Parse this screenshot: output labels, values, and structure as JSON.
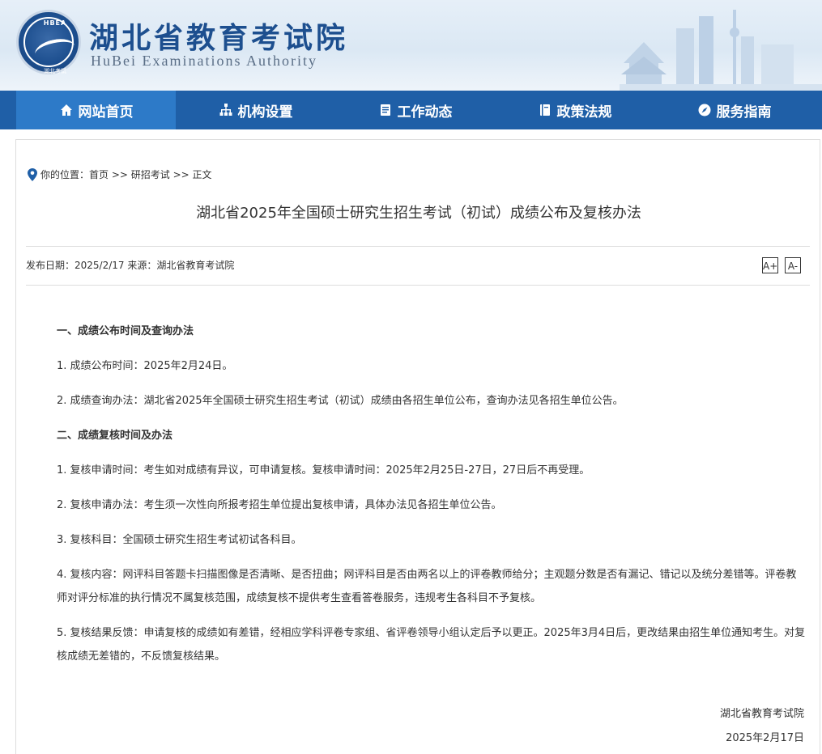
{
  "header": {
    "logo_top_text": "HBEA",
    "logo_bottom_text": "湖北考试",
    "title": "湖北省教育考试院",
    "subtitle": "HuBei Examinations Authority"
  },
  "nav": {
    "items": [
      {
        "label": "网站首页",
        "icon": "home-icon"
      },
      {
        "label": "机构设置",
        "icon": "org-chart-icon"
      },
      {
        "label": "工作动态",
        "icon": "document-icon"
      },
      {
        "label": "政策法规",
        "icon": "book-icon"
      },
      {
        "label": "服务指南",
        "icon": "compass-icon"
      }
    ]
  },
  "breadcrumb": {
    "prefix": "你的位置：",
    "home": "首页",
    "sep1": " >> ",
    "section": "研招考试",
    "sep2": " >> ",
    "current": "正文"
  },
  "article": {
    "title": "湖北省2025年全国硕士研究生招生考试（初试）成绩公布及复核办法",
    "meta": "发布日期：2025/2/17 来源：湖北省教育考试院",
    "font_larger": "A+",
    "font_smaller": "A-",
    "paragraphs": [
      {
        "text": "一、成绩公布时间及查询办法",
        "heading": true
      },
      {
        "text": "1. 成绩公布时间：2025年2月24日。",
        "heading": false
      },
      {
        "text": "2. 成绩查询办法：湖北省2025年全国硕士研究生招生考试（初试）成绩由各招生单位公布，查询办法见各招生单位公告。",
        "heading": false
      },
      {
        "text": "二、成绩复核时间及办法",
        "heading": true
      },
      {
        "text": "1. 复核申请时间：考生如对成绩有异议，可申请复核。复核申请时间：2025年2月25日-27日，27日后不再受理。",
        "heading": false
      },
      {
        "text": "2. 复核申请办法：考生须一次性向所报考招生单位提出复核申请，具体办法见各招生单位公告。",
        "heading": false
      },
      {
        "text": "3. 复核科目：全国硕士研究生招生考试初试各科目。",
        "heading": false
      },
      {
        "text": "4. 复核内容：网评科目答题卡扫描图像是否清晰、是否扭曲；网评科目是否由两名以上的评卷教师给分；主观题分数是否有漏记、错记以及统分差错等。评卷教师对评分标准的执行情况不属复核范围，成绩复核不提供考生查看答卷服务，违规考生各科目不予复核。",
        "heading": false
      },
      {
        "text": "5. 复核结果反馈：申请复核的成绩如有差错，经相应学科评卷专家组、省评卷领导小组认定后予以更正。2025年3月4日后，更改结果由招生单位通知考生。对复核成绩无差错的，不反馈复核结果。",
        "heading": false
      }
    ],
    "signature_org": "湖北省教育考试院",
    "signature_date": "2025年2月17日"
  }
}
